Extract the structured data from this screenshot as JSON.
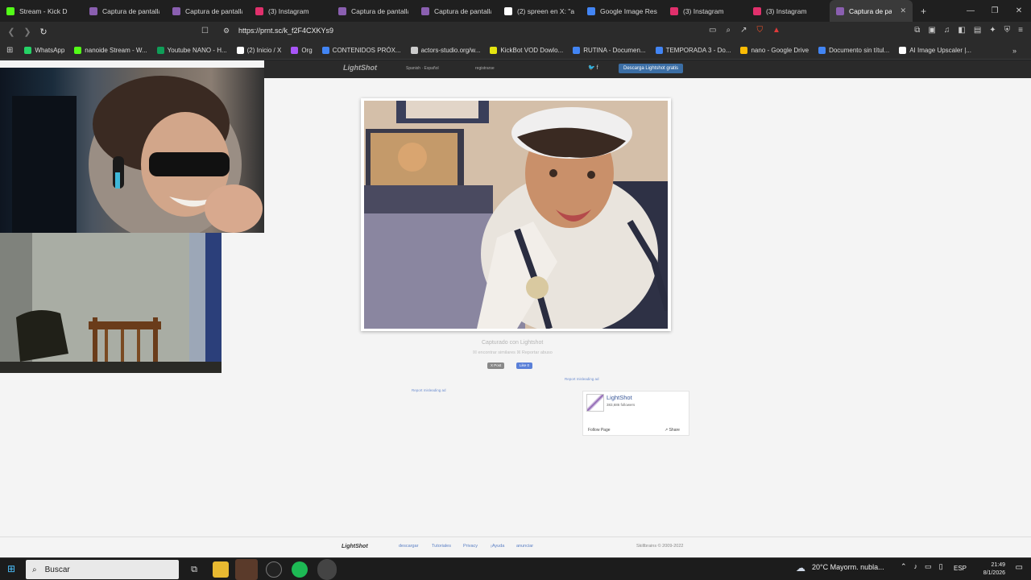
{
  "tabs": [
    {
      "label": "Stream - Kick D",
      "favicon_color": "#53fc18"
    },
    {
      "label": "Captura de pantalla",
      "favicon_color": "#8a5fb0"
    },
    {
      "label": "Captura de pantalla",
      "favicon_color": "#8a5fb0"
    },
    {
      "label": "(3) Instagram",
      "favicon_color": "#e1306c"
    },
    {
      "label": "Captura de pantalla",
      "favicon_color": "#8a5fb0"
    },
    {
      "label": "Captura de pantalla",
      "favicon_color": "#8a5fb0"
    },
    {
      "label": "(2) spreen en X: \"ag",
      "favicon_color": "#ffffff"
    },
    {
      "label": "Google Image Resu",
      "favicon_color": "#4285f4"
    },
    {
      "label": "(3) Instagram",
      "favicon_color": "#e1306c"
    },
    {
      "label": "(3) Instagram",
      "favicon_color": "#e1306c"
    },
    {
      "label": "Captura de par",
      "favicon_color": "#8a5fb0",
      "active": true
    }
  ],
  "new_tab": "+",
  "window_controls": {
    "minimize": "—",
    "restore": "❐",
    "close": "✕"
  },
  "address": {
    "url": "https://prnt.sc/k_f2F4CXKYs9"
  },
  "bookmarks": [
    {
      "label": "WhatsApp",
      "favicon_color": "#25d366"
    },
    {
      "label": "nanoide Stream - W...",
      "favicon_color": "#53fc18"
    },
    {
      "label": "Youtube NANO - H...",
      "favicon_color": "#0f9d58"
    },
    {
      "label": "(2) Inicio / X",
      "favicon_color": "#ffffff"
    },
    {
      "label": "Org",
      "favicon_color": "#a855f7"
    },
    {
      "label": "CONTENIDOS PRÓX...",
      "favicon_color": "#4285f4"
    },
    {
      "label": "actors-studio.org/w...",
      "favicon_color": "#cccccc"
    },
    {
      "label": "KickBot VOD Dowlo...",
      "favicon_color": "#e5e510"
    },
    {
      "label": "RUTINA - Documen...",
      "favicon_color": "#4285f4"
    },
    {
      "label": "TEMPORADA 3 - Do...",
      "favicon_color": "#4285f4"
    },
    {
      "label": "nano - Google Drive",
      "favicon_color": "#fbbc04"
    },
    {
      "label": "Documento sin títul...",
      "favicon_color": "#4285f4"
    },
    {
      "label": "AI Image Upscaler |...",
      "favicon_color": "#ffffff"
    }
  ],
  "lightshot": {
    "logo": "LightShot",
    "language": "Spanish · Español",
    "register": "registrarse",
    "social": "🐦 f",
    "download_button": "Descarga Lightshot gratis",
    "caption": "Capturado con Lightshot",
    "sublinks": "☒ encontrar similares  ☒ Reportar abuso",
    "post_button": "X Post",
    "like_button": "Like 0",
    "report_ad_1": "Report misleading ad",
    "report_ad_2": "Report misleading ad",
    "fb_name": "LightShot",
    "fb_followers": "383,686 followers",
    "fb_follow": "Follow Page",
    "fb_share": "↗ Share",
    "footer": {
      "logo": "LightShot",
      "links": [
        "descargar",
        "Tutoriales",
        "Privacy",
        "¡Ayuda",
        "anunciar"
      ],
      "copyright": "Skillbrains © 2009-2022"
    }
  },
  "taskbar": {
    "search_placeholder": "Buscar",
    "weather": "20°C  Mayorm. nubla...",
    "language": "ESP",
    "time": "21:49",
    "date": "8/1/2026"
  }
}
